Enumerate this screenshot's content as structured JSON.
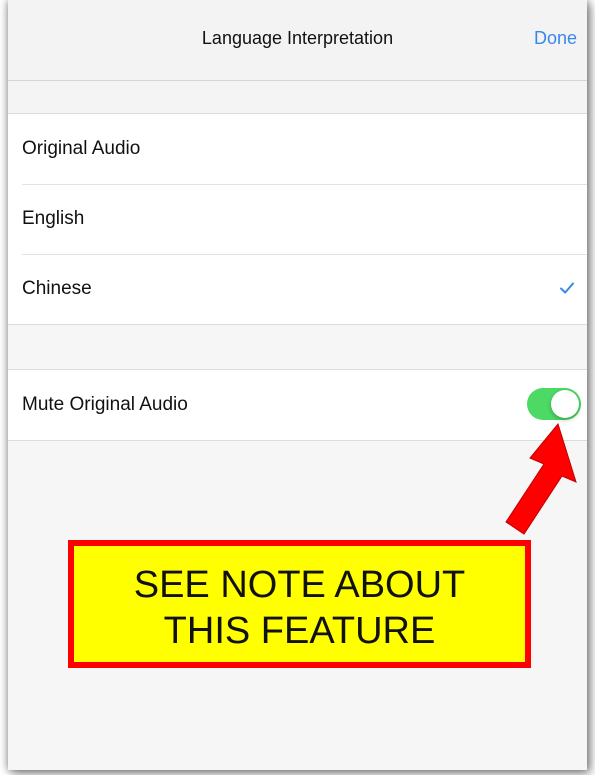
{
  "navbar": {
    "title": "Language Interpretation",
    "done_label": "Done"
  },
  "languages": {
    "items": [
      {
        "label": "Original Audio",
        "selected": false
      },
      {
        "label": "English",
        "selected": false
      },
      {
        "label": "Chinese",
        "selected": true
      }
    ]
  },
  "mute": {
    "label": "Mute Original Audio",
    "enabled": true
  },
  "annotation": {
    "line1": "SEE NOTE ABOUT",
    "line2": "THIS FEATURE"
  },
  "colors": {
    "accent": "#3a87ea",
    "toggle_on": "#4cd964",
    "note_background": "#ffff00",
    "note_border": "#ff0000",
    "arrow": "#ff0000"
  },
  "icons": {
    "selected_marker": "checkmark-icon",
    "pointer": "arrow-icon"
  }
}
